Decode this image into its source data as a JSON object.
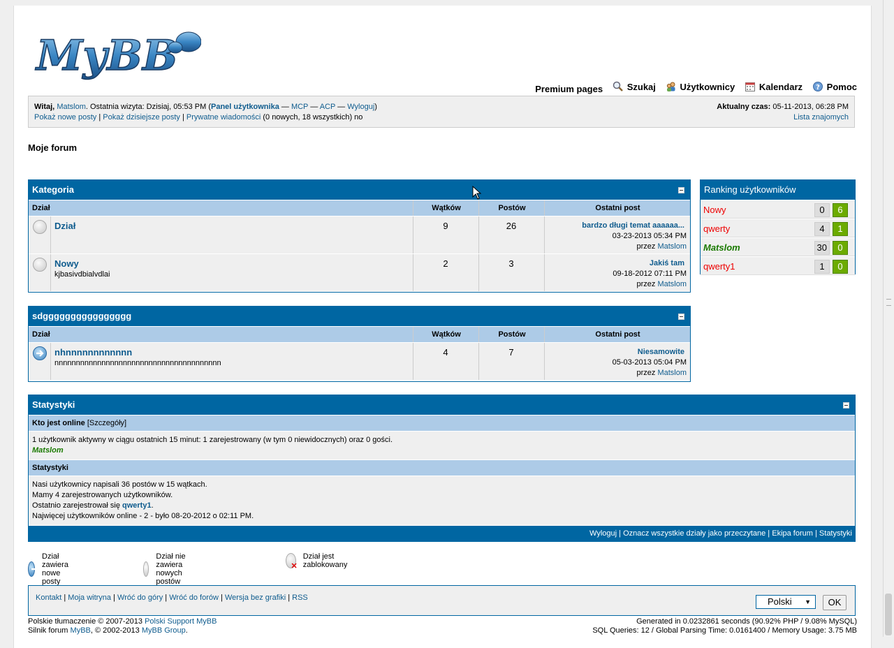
{
  "header": {
    "logo_text": "MyBB",
    "menu": [
      {
        "label": "Premium pages",
        "icon": ""
      },
      {
        "label": "Szukaj",
        "icon": "search-icon"
      },
      {
        "label": "Użytkownicy",
        "icon": "users-icon"
      },
      {
        "label": "Kalendarz",
        "icon": "calendar-icon"
      },
      {
        "label": "Pomoc",
        "icon": "help-icon"
      }
    ]
  },
  "welcome": {
    "greeting": "Witaj,",
    "username": "Matslom",
    "last_visit": ". Ostatnia wizyta: Dzisiaj, 05:53 PM (",
    "user_panel": "Panel użytkownika",
    "dash1": " — ",
    "mcp": "MCP",
    "dash2": " — ",
    "acp": "ACP",
    "dash3": " — ",
    "logout": "Wyloguj",
    "close_paren": ")",
    "new_posts": "Pokaż nowe posty",
    "pipe1": " | ",
    "today_posts": "Pokaż dzisiejsze posty",
    "pipe2": " | ",
    "pm": "Prywatne wiadomości",
    "pm_counts": " (0 nowych, 18 wszystkich) no",
    "time_label": "Aktualny czas:",
    "time_value": " 05-11-2013, 06:28 PM",
    "buddy_list": "Lista znajomych"
  },
  "forum_title": "Moje forum",
  "columns": {
    "forum": "Dział",
    "threads": "Wątków",
    "posts": "Postów",
    "lastpost": "Ostatni post"
  },
  "categories": [
    {
      "title": "Kategoria",
      "forums": [
        {
          "name": "Dział",
          "desc": "",
          "threads": "9",
          "posts": "26",
          "last_title": "bardzo długi temat aaaaaa...",
          "last_date": "03-23-2013 05:34 PM",
          "by": "przez ",
          "last_user": "Matslom",
          "status": "off"
        },
        {
          "name": "Nowy",
          "desc": "kjbasivdbialvdlai",
          "threads": "2",
          "posts": "3",
          "last_title": "Jakiś tam",
          "last_date": "09-18-2012 07:11 PM",
          "by": "przez ",
          "last_user": "Matslom",
          "status": "off"
        }
      ]
    },
    {
      "title": "sdgggggggggggggggg",
      "forums": [
        {
          "name": "nhnnnnnnnnnnnn",
          "desc": "nnnnnnnnnnnnnnnnnnnnnnnnnnnnnnnnnnnnnnn",
          "threads": "4",
          "posts": "7",
          "last_title": "Niesamowite",
          "last_date": "05-03-2013 05:04 PM",
          "by": "przez ",
          "last_user": "Matslom",
          "status": "on"
        }
      ]
    }
  ],
  "ranking": {
    "title": "Ranking użytkowników",
    "rows": [
      {
        "name": "Nowy",
        "a": "0",
        "b": "6",
        "color": "#e00000",
        "style": "normal"
      },
      {
        "name": "qwerty",
        "a": "4",
        "b": "1",
        "color": "#e00000",
        "style": "normal"
      },
      {
        "name": "Matslom",
        "a": "30",
        "b": "0",
        "color": "#1a7a00",
        "style": "bold-italic"
      },
      {
        "name": "qwerty1",
        "a": "1",
        "b": "0",
        "color": "#e00000",
        "style": "normal"
      }
    ]
  },
  "stats": {
    "title": "Statystyki",
    "online_heading": "Kto jest online",
    "online_details": " [Szczegóły]",
    "online_text": "1 użytkownik aktywny w ciągu ostatnich 15 minut: 1 zarejestrowany (w tym 0 niewidocznych) oraz 0 gości.",
    "online_user": "Matslom",
    "stats_heading": "Statystyki",
    "line1": "Nasi użytkownicy napisali 36 postów w 15 wątkach.",
    "line2": "Mamy 4 zarejestrowanych użytkowników.",
    "line3_prefix": "Ostatnio zarejestrował się ",
    "line3_user": "qwerty1",
    "line3_suffix": ".",
    "line4": "Najwięcej użytkowników online - 2 - było 08-20-2012 o 02:11 PM.",
    "footer_links": [
      "Wyloguj",
      "Oznacz wszystkie działy jako przeczytane",
      "Ekipa forum",
      "Statystyki"
    ],
    "footer_sep": " | "
  },
  "legend": {
    "new": "Dział zawiera nowe posty",
    "nonew": "Dział nie zawiera nowych postów",
    "locked": "Dział jest zablokowany"
  },
  "footer": {
    "links": [
      "Kontakt",
      "Moja witryna",
      "Wróć do góry",
      "Wróć do forów",
      "Wersja bez grafiki",
      "RSS"
    ],
    "sep": " | ",
    "language": "Polski",
    "ok": "OK",
    "copy1_prefix": "Polskie tłumaczenie © 2007-2013 ",
    "copy1_link": "Polski Support MyBB",
    "copy2_prefix": "Silnik forum ",
    "copy2_link1": "MyBB",
    "copy2_mid": ", © 2002-2013 ",
    "copy2_link2": "MyBB Group",
    "copy2_suffix": ".",
    "debug1": "Generated in 0.0232861 seconds (90.92% PHP / 9.08% MySQL)",
    "debug2": "SQL Queries: 12 / Global Parsing Time: 0.0161400 / Memory Usage: 3.75 MB"
  }
}
